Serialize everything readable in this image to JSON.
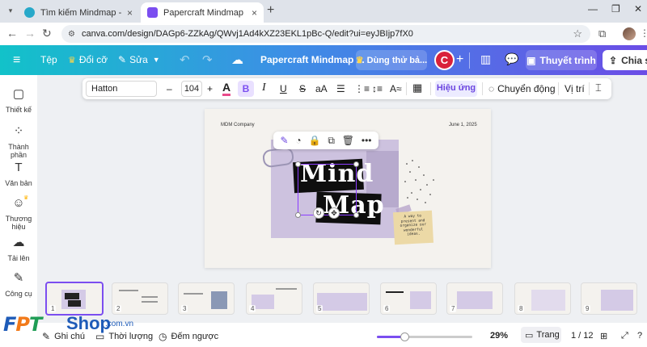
{
  "browser": {
    "tabs": [
      {
        "title": "Tìm kiếm Mindmap - Canva"
      },
      {
        "title": "Papercraft Mindmap Brainstorm"
      }
    ],
    "new_tab": "+",
    "url": "canva.com/design/DAGp6-ZZkAg/QWvj1Ad4kXZ23EKL1pBc-Q/edit?ui=eyJBIjp7fX0"
  },
  "header": {
    "file": "Tệp",
    "resize": "Đổi cỡ",
    "edit": "Sửa",
    "doc_title": "Papercraft Mindmap ...",
    "try": "Dùng thử bả...",
    "avatar_letter": "C",
    "present": "Thuyết trình",
    "share": "Chia sẻ"
  },
  "sidebar": {
    "items": [
      {
        "label": "Thiết kế"
      },
      {
        "label": "Thành phần"
      },
      {
        "label": "Văn bản"
      },
      {
        "label": "Thương hiệu"
      },
      {
        "label": "Tải lên"
      },
      {
        "label": "Công cụ"
      }
    ]
  },
  "toolbar": {
    "font": "Hatton",
    "minus": "–",
    "size": "104",
    "plus": "+",
    "font_color_glyph": "A",
    "bold": "B",
    "italic": "I",
    "underline": "U",
    "strike": "S",
    "case": "aA",
    "effects": "Hiệu ứng",
    "animate": "Chuyển động",
    "position": "Vị trí"
  },
  "canvas": {
    "company": "MDM Company",
    "date": "June 1, 2025",
    "title_line1": "Mind",
    "title_line2": "Map",
    "sticky_lines": [
      "A way to",
      "present and",
      "organize our",
      "wonderful",
      "ideas."
    ]
  },
  "thumbnails": {
    "pages": [
      "1",
      "2",
      "3",
      "4",
      "5",
      "6",
      "7",
      "8",
      "9"
    ],
    "selected": 1
  },
  "bottom": {
    "notes": "Ghi chú",
    "duration": "Thời lượng",
    "timer": "Đếm ngược",
    "zoom": "29%",
    "zoom_fraction": 0.29,
    "pages": "Trang",
    "page_count": "1 / 12"
  },
  "watermark": {
    "logo": "FPT",
    "shop": "Shop",
    "domain": ".com.vn"
  },
  "colors": {
    "accent": "#7b4ef0",
    "header_start": "#12c2c9",
    "header_end": "#6b4de6",
    "avatar": "#d9213a",
    "lavender": "#cdc2df"
  }
}
